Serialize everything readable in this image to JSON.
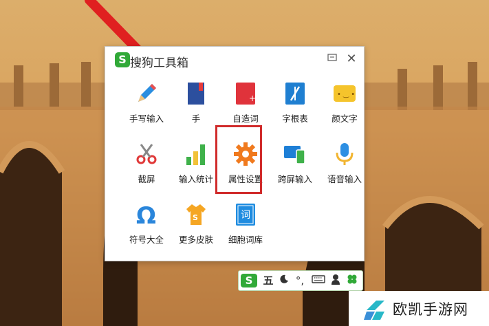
{
  "toolbox": {
    "title": "搜狗工具箱",
    "logo_letter": "S",
    "tools": [
      {
        "label": "手写输入",
        "icon": "pencil-icon"
      },
      {
        "label": "手",
        "icon": "book-icon"
      },
      {
        "label": "自造词",
        "icon": "custom-word-icon"
      },
      {
        "label": "字根表",
        "icon": "radical-table-icon"
      },
      {
        "label": "颜文字",
        "icon": "emoticon-icon"
      },
      {
        "label": "截屏",
        "icon": "scissors-icon"
      },
      {
        "label": "输入统计",
        "icon": "bar-stats-icon"
      },
      {
        "label": "属性设置",
        "icon": "gear-icon"
      },
      {
        "label": "跨屏输入",
        "icon": "cross-screen-icon"
      },
      {
        "label": "语音输入",
        "icon": "microphone-icon"
      },
      {
        "label": "符号大全",
        "icon": "omega-icon"
      },
      {
        "label": "更多皮肤",
        "icon": "tshirt-icon"
      },
      {
        "label": "细胞词库",
        "icon": "cell-dictionary-icon"
      }
    ],
    "cell_icon_char": "词"
  },
  "statusbar": {
    "logo_letter": "S",
    "mode_label": "五",
    "punct_label": "°,",
    "icons": [
      "moon-icon",
      "keyboard-icon",
      "user-icon",
      "clover-icon"
    ]
  },
  "watermark": {
    "text": "欧凯手游网"
  },
  "colors": {
    "sogou_green": "#31a938",
    "highlight_red": "#d02b2b",
    "gear_orange": "#f07a1e",
    "arrow_red": "#e02020"
  }
}
